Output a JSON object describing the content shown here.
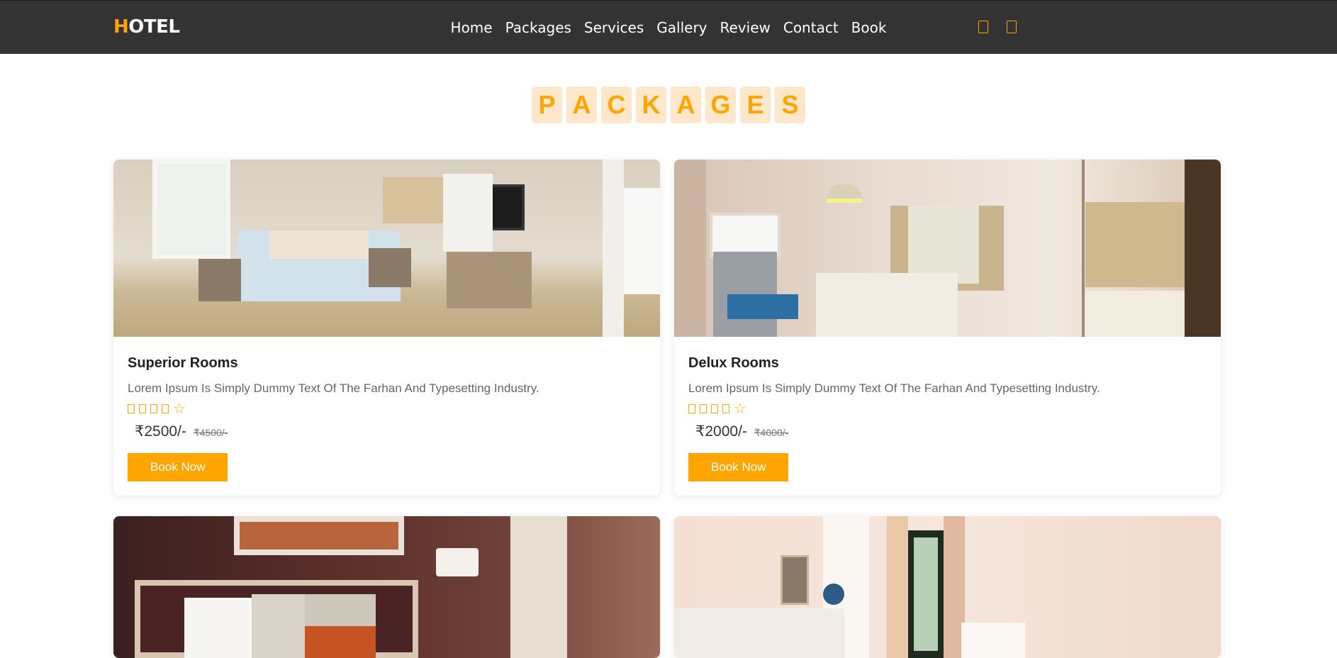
{
  "header": {
    "logo_first": "H",
    "logo_rest": "OTEL",
    "nav": [
      "Home",
      "Packages",
      "Services",
      "Gallery",
      "Review",
      "Contact",
      "Book"
    ],
    "icons": [
      "cart-icon",
      "user-icon"
    ]
  },
  "section": {
    "title_letters": [
      "P",
      "A",
      "C",
      "K",
      "A",
      "G",
      "E",
      "S"
    ]
  },
  "packages": [
    {
      "title": "Superior Rooms",
      "description": "Lorem Ipsum Is Simply Dummy Text Of The Farhan And Typesetting Industry.",
      "rating": 4,
      "price": "₹2500/-",
      "old_price": "₹4500/-",
      "button": "Book Now"
    },
    {
      "title": "Delux Rooms",
      "description": "Lorem Ipsum Is Simply Dummy Text Of The Farhan And Typesetting Industry.",
      "rating": 4,
      "price": "₹2000/-",
      "old_price": "₹4000/-",
      "button": "Book Now"
    }
  ],
  "colors": {
    "accent": "#ffa500",
    "header_bg": "#333333",
    "title_tile_bg": "#ffe7cc"
  }
}
